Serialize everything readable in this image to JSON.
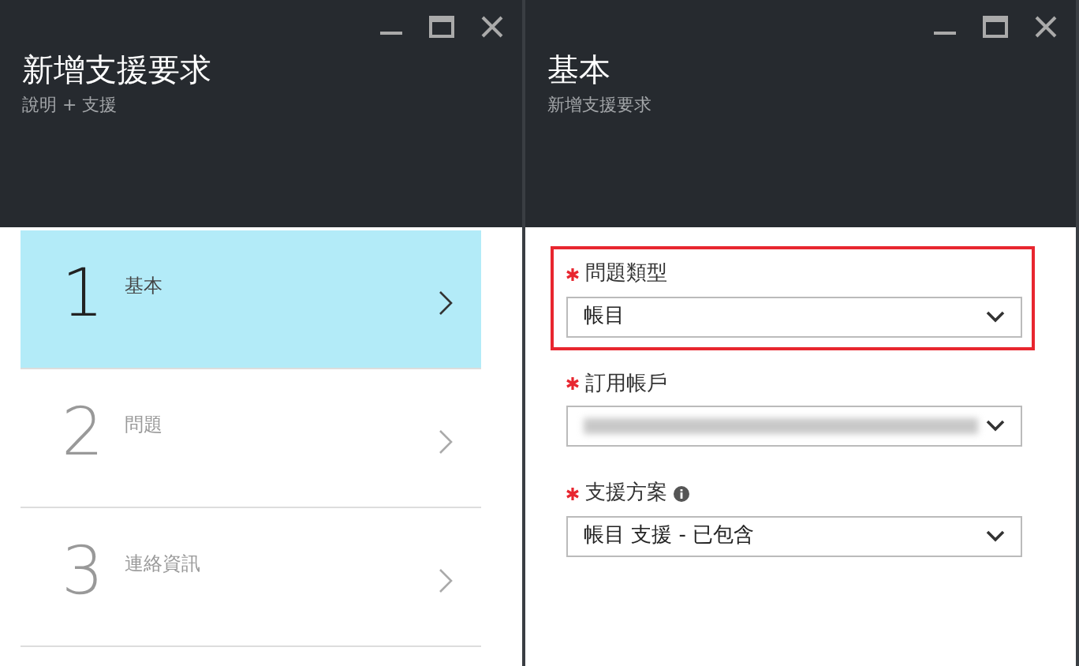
{
  "blades": [
    {
      "title": "新增支援要求",
      "subtitle": "說明 + 支援",
      "steps": [
        {
          "number": "1",
          "label": "基本",
          "selected": true
        },
        {
          "number": "2",
          "label": "問題",
          "selected": false
        },
        {
          "number": "3",
          "label": "連絡資訊",
          "selected": false
        }
      ]
    },
    {
      "title": "基本",
      "subtitle": "新增支援要求",
      "fields": [
        {
          "label": "問題類型",
          "required": true,
          "info": false,
          "highlighted": true,
          "value": "帳目",
          "redacted": false
        },
        {
          "label": "訂用帳戶",
          "required": true,
          "info": false,
          "highlighted": false,
          "redacted": true
        },
        {
          "label": "支援方案",
          "required": true,
          "info": true,
          "highlighted": false,
          "value": "帳目 支援 - 已包含",
          "redacted": false
        }
      ]
    }
  ]
}
